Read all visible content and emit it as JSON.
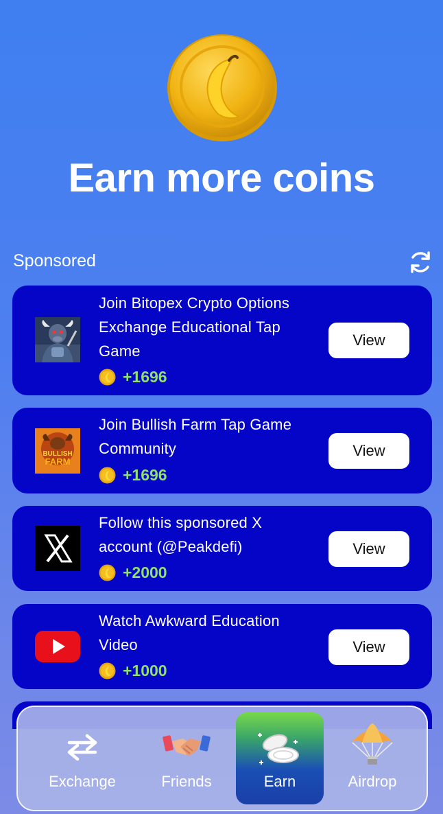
{
  "header": {
    "title": "Earn more coins",
    "hero_icon": "banana-coin-icon"
  },
  "sponsored": {
    "label": "Sponsored",
    "refresh_icon": "refresh-icon",
    "items": [
      {
        "thumb": "bull-warrior-thumbnail",
        "title": "Join Bitopex Crypto Options Exchange Educational Tap Game",
        "reward": "+1696",
        "button": "View"
      },
      {
        "thumb": "bullish-farm-logo",
        "thumb_text": "BULLISH FARM",
        "title": "Join Bullish Farm Tap Game Community",
        "reward": "+1696",
        "button": "View"
      },
      {
        "thumb": "x-logo-icon",
        "title": "Follow this sponsored X account (@Peakdefi)",
        "reward": "+2000",
        "button": "View"
      },
      {
        "thumb": "youtube-logo-icon",
        "title": "Watch Awkward Education Video",
        "reward": "+1000",
        "button": "View"
      }
    ]
  },
  "nav": {
    "items": [
      {
        "label": "Exchange",
        "icon": "exchange-arrows-icon",
        "active": false
      },
      {
        "label": "Friends",
        "icon": "handshake-icon",
        "active": false
      },
      {
        "label": "Earn",
        "icon": "coins-stack-icon",
        "active": true
      },
      {
        "label": "Airdrop",
        "icon": "parachute-icon",
        "active": false
      }
    ]
  },
  "colors": {
    "card_bg": "#0505c8",
    "reward_green": "#8ee070",
    "coin_gold": "#f2b415"
  }
}
